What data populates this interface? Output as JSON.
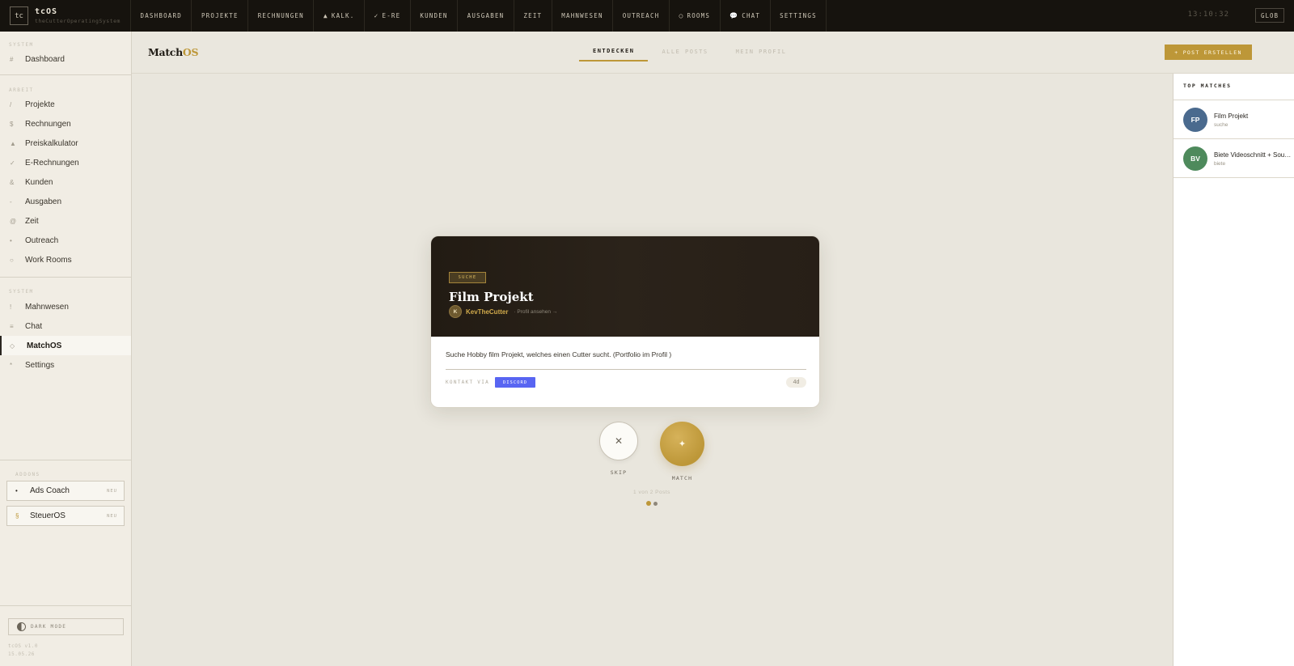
{
  "topbar": {
    "logo_mark": "tc",
    "logo_title": "tcOS",
    "logo_sub": "theCutterOperatingSystem",
    "nav": [
      {
        "icon": "",
        "label": "DASHBOARD"
      },
      {
        "icon": "",
        "label": "PROJEKTE"
      },
      {
        "icon": "",
        "label": "RECHNUNGEN"
      },
      {
        "icon": "▲",
        "label": "KALK."
      },
      {
        "icon": "✓",
        "label": "E-RE"
      },
      {
        "icon": "",
        "label": "KUNDEN"
      },
      {
        "icon": "",
        "label": "AUSGABEN"
      },
      {
        "icon": "",
        "label": "ZEIT"
      },
      {
        "icon": "",
        "label": "MAHNWESEN"
      },
      {
        "icon": "",
        "label": "OUTREACH"
      },
      {
        "icon": "○",
        "label": "ROOMS"
      },
      {
        "icon": "💬",
        "label": "CHAT"
      },
      {
        "icon": "",
        "label": "SETTINGS"
      }
    ],
    "clock": "13:10:32",
    "glob_label": "GLOB"
  },
  "sidebar": {
    "section_system_top": "SYSTEM",
    "dashboard": {
      "icon": "#",
      "label": "Dashboard"
    },
    "section_arbeit": "ARBEIT",
    "arbeit_items": [
      {
        "icon": "/",
        "label": "Projekte"
      },
      {
        "icon": "$",
        "label": "Rechnungen"
      },
      {
        "icon": "▲",
        "label": "Preiskalkulator"
      },
      {
        "icon": "✓",
        "label": "E-Rechnungen"
      },
      {
        "icon": "&",
        "label": "Kunden"
      },
      {
        "icon": "-",
        "label": "Ausgaben"
      },
      {
        "icon": "@",
        "label": "Zeit"
      },
      {
        "icon": "•",
        "label": "Outreach"
      },
      {
        "icon": "○",
        "label": "Work Rooms"
      }
    ],
    "section_system": "SYSTEM",
    "system_items": [
      {
        "icon": "!",
        "label": "Mahnwesen"
      },
      {
        "icon": "≡",
        "label": "Chat"
      },
      {
        "icon": "◇",
        "label": "MatchOS"
      },
      {
        "icon": "*",
        "label": "Settings"
      }
    ],
    "section_addons": "ADDONS",
    "addons": [
      {
        "icon": "•",
        "label": "Ads Coach",
        "badge": "NEU"
      },
      {
        "icon": "§",
        "label": "SteuerOS",
        "badge": "NEU"
      }
    ],
    "dark_mode_label": "DARK MODE",
    "version": "tcOS v1.0",
    "date": "15.05.26"
  },
  "header": {
    "brand_a": "Match",
    "brand_b": "OS",
    "tabs": [
      "ENTDECKEN",
      "ALLE POSTS",
      "MEIN PROFIL"
    ],
    "post_button": "+ POST ERSTELLEN"
  },
  "top_matches": {
    "title": "TOP MATCHES",
    "items": [
      {
        "initials": "FP",
        "name": "Film Projekt",
        "type": "suche",
        "color": "#4a6a8e"
      },
      {
        "initials": "BV",
        "name": "Biete Videoschnitt + Sounddesign",
        "type": "biete",
        "color": "#4e8a5c"
      }
    ]
  },
  "card": {
    "tag": "SUCHE",
    "title": "Film Projekt",
    "author_initial": "K",
    "author": "KevTheCutter",
    "profile_link": "· Profil ansehen →",
    "text": "Suche Hobby film Projekt, welches einen Cutter sucht. (Portfolio im Profil )",
    "contact_label": "KONTAKT VIA",
    "contact_channel": "DISCORD",
    "age": "4d"
  },
  "actions": {
    "skip_icon": "✕",
    "skip_label": "SKIP",
    "match_icon": "✦",
    "match_label": "MATCH",
    "counter": "1 von 2 Posts"
  },
  "colors": {
    "accent": "#bd9738",
    "topbar": "#16130e",
    "discord": "#5865f2"
  }
}
